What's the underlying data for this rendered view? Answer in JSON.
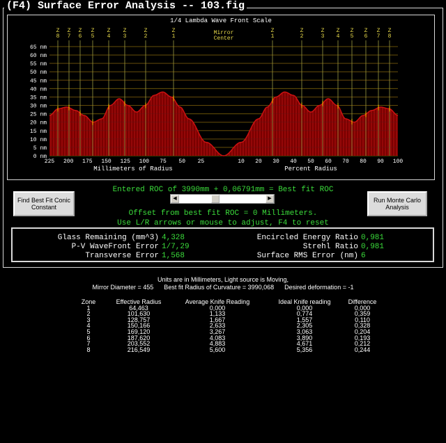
{
  "window_title": "(F4)  Surface Error Analysis -- 103.fig",
  "chart": {
    "title": "1/4 Lambda Wave Front Scale",
    "y_ticks": [
      "65 nm",
      "60 nm",
      "55 nm",
      "50 nm",
      "45 nm",
      "40 nm",
      "35 nm",
      "30 nm",
      "25 nm",
      "20 nm",
      "15 nm",
      "10 nm",
      "5 nm",
      "0 nm"
    ],
    "left_ticks": [
      "225",
      "200",
      "175",
      "150",
      "125",
      "100",
      "75",
      "50",
      "25"
    ],
    "right_ticks": [
      "10",
      "20",
      "30",
      "40",
      "50",
      "60",
      "70",
      "80",
      "90",
      "100"
    ],
    "left_axis_label": "Millimeters of Radius",
    "right_axis_label": "Percent Radius",
    "center_label_1": "Mirror",
    "center_label_2": "Center",
    "zone_labels_left": [
      "Z8",
      "Z7",
      "Z6",
      "Z5",
      "Z4",
      "Z3",
      "Z2",
      "Z1"
    ],
    "zone_labels_right": [
      "Z1",
      "Z2",
      "Z3",
      "Z4",
      "Z5",
      "Z6",
      "Z7",
      "Z8"
    ],
    "colors": {
      "curve": "#cc1111",
      "fill": "#7a0000",
      "grid": "#6a6a00",
      "zone_line": "#9a9a40",
      "zone_text": "#e6d84a"
    }
  },
  "chart_data": {
    "type": "area",
    "title": "1/4 Lambda Wave Front Scale",
    "ylabel": "nm",
    "ylim": [
      0,
      65
    ],
    "left_axis": {
      "label": "Millimeters of Radius",
      "range": [
        225,
        0
      ]
    },
    "right_axis": {
      "label": "Percent Radius",
      "range": [
        0,
        100
      ]
    },
    "series": [
      {
        "x_percent": [
          0,
          10,
          20,
          25,
          30,
          35,
          40,
          45,
          50,
          55,
          60,
          65,
          70,
          75,
          80,
          85,
          90,
          95,
          100
        ],
        "values": [
          0,
          8,
          22,
          29,
          35,
          38,
          36,
          30,
          26,
          30,
          34,
          30,
          22,
          20,
          24,
          27,
          29,
          28,
          24
        ]
      }
    ]
  },
  "controls": {
    "find_best_fit_btn": "Find Best Fit Conic Constant",
    "monte_carlo_btn": "Run Monte Carlo Analysis",
    "entered_roc": "Entered ROC of 3990mm + 0,06791mm = Best fit ROC",
    "offset_text": "Offset from best fit ROC = 0 Millimeters.",
    "adjust_text": "Use L/R arrows or mouse to adjust, F4 to reset"
  },
  "stats": {
    "glass_label": "Glass Remaining (mm^3)",
    "glass_val": "4,328",
    "pv_label": "P-V WaveFront Error",
    "pv_val": "1/7,29",
    "transverse_label": "Transverse Error",
    "transverse_val": "1,568",
    "encircled_label": "Encircled Energy Ratio",
    "encircled_val": "0,981",
    "strehl_label": "Strehl Ratio",
    "strehl_val": "0,981",
    "rms_label": "Surface RMS Error (nm)",
    "rms_val": "6"
  },
  "info": {
    "units": "Units are in Millimeters, Light source is Moving,",
    "diameter_line": "Mirror Diameter = 455      Best fit Radius of Curvature = 3990,068      Desired deformation = -1"
  },
  "table": {
    "headers": [
      "Zone",
      "Effective Radius",
      "Average Knife Reading",
      "Ideal Knife reading",
      "Difference"
    ],
    "rows": [
      [
        "1",
        "64,463",
        "0,000",
        "0,000",
        "0,000"
      ],
      [
        "2",
        "101,630",
        "1,133",
        "0,774",
        "0,359"
      ],
      [
        "3",
        "128,757",
        "1,667",
        "1,557",
        "0,110"
      ],
      [
        "4",
        "150,166",
        "2,633",
        "2,305",
        "0,328"
      ],
      [
        "5",
        "169,120",
        "3,267",
        "3,063",
        "0,204"
      ],
      [
        "6",
        "187,620",
        "4,083",
        "3,890",
        "0,193"
      ],
      [
        "7",
        "203,552",
        "4,883",
        "4,671",
        "0,212"
      ],
      [
        "8",
        "216,549",
        "5,600",
        "5,356",
        "0,244"
      ]
    ]
  }
}
